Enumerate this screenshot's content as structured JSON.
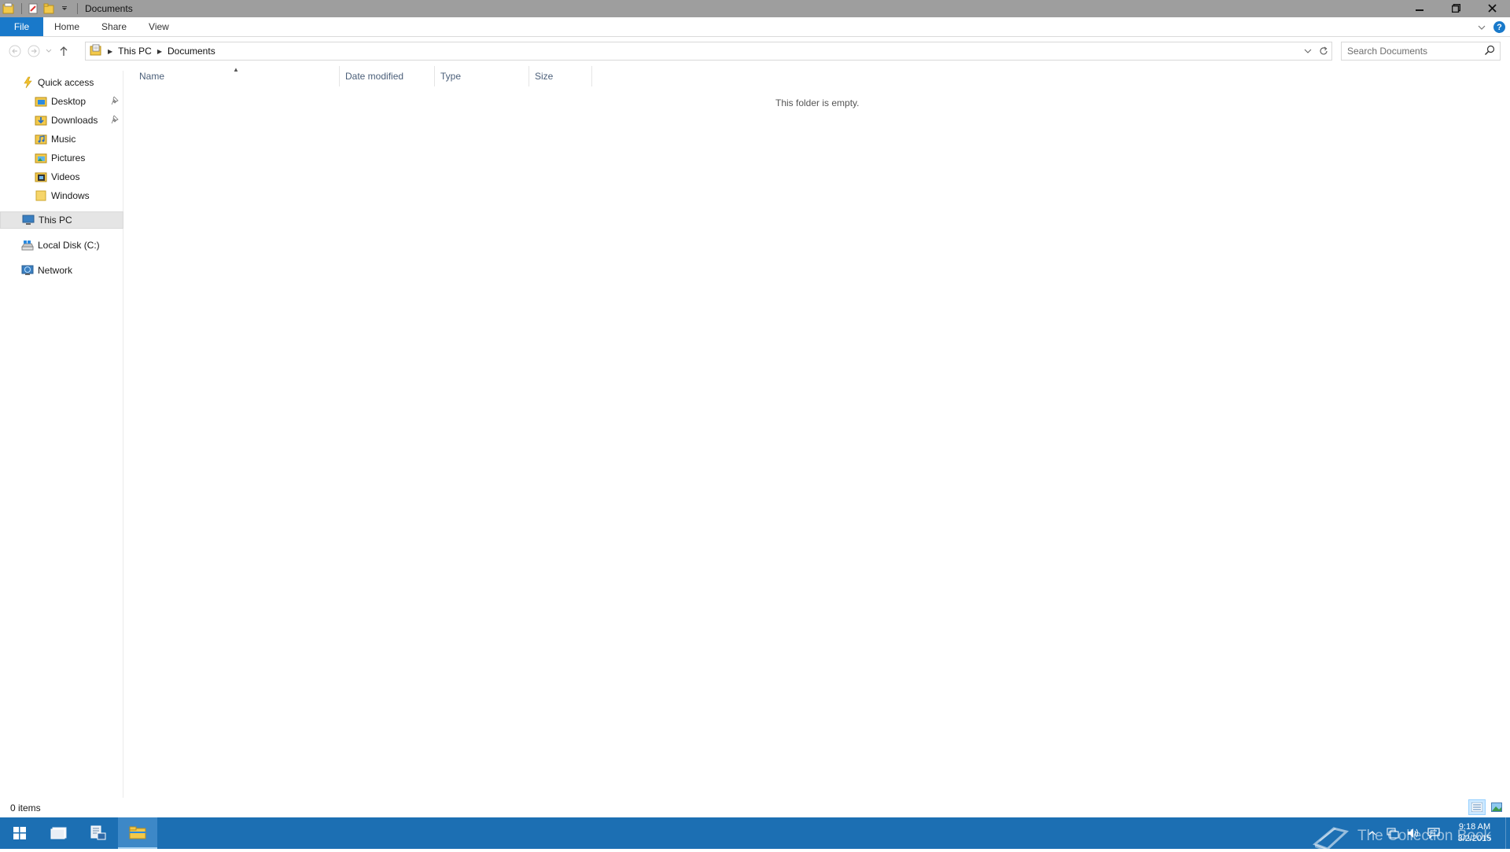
{
  "window": {
    "title": "Documents",
    "controls": {
      "minimize": "minimize",
      "restore": "restore",
      "close": "close"
    }
  },
  "ribbon": {
    "tabs": [
      "File",
      "Home",
      "Share",
      "View"
    ],
    "help": "?"
  },
  "navbar": {
    "breadcrumbs": [
      "This PC",
      "Documents"
    ],
    "search_placeholder": "Search Documents"
  },
  "navpane": {
    "quick_access": "Quick access",
    "quick_items": [
      {
        "label": "Desktop",
        "icon": "desktop-folder-icon",
        "pinned": true
      },
      {
        "label": "Downloads",
        "icon": "downloads-folder-icon",
        "pinned": true
      },
      {
        "label": "Music",
        "icon": "music-folder-icon",
        "pinned": false
      },
      {
        "label": "Pictures",
        "icon": "pictures-folder-icon",
        "pinned": false
      },
      {
        "label": "Videos",
        "icon": "videos-folder-icon",
        "pinned": false
      },
      {
        "label": "Windows",
        "icon": "folder-icon",
        "pinned": false
      }
    ],
    "this_pc": "This PC",
    "local_disk": "Local Disk (C:)",
    "network": "Network"
  },
  "filelist": {
    "columns": [
      "Name",
      "Date modified",
      "Type",
      "Size"
    ],
    "empty_message": "This folder is empty."
  },
  "status": {
    "item_count": "0 items"
  },
  "taskbar": {
    "clock_time": "9:18 AM",
    "clock_date": "3/2/2015",
    "watermark": "The Collection Book"
  },
  "colors": {
    "accent": "#1979ca",
    "titlebar": "#9e9e9e",
    "taskbar": "#1c6fb3"
  }
}
